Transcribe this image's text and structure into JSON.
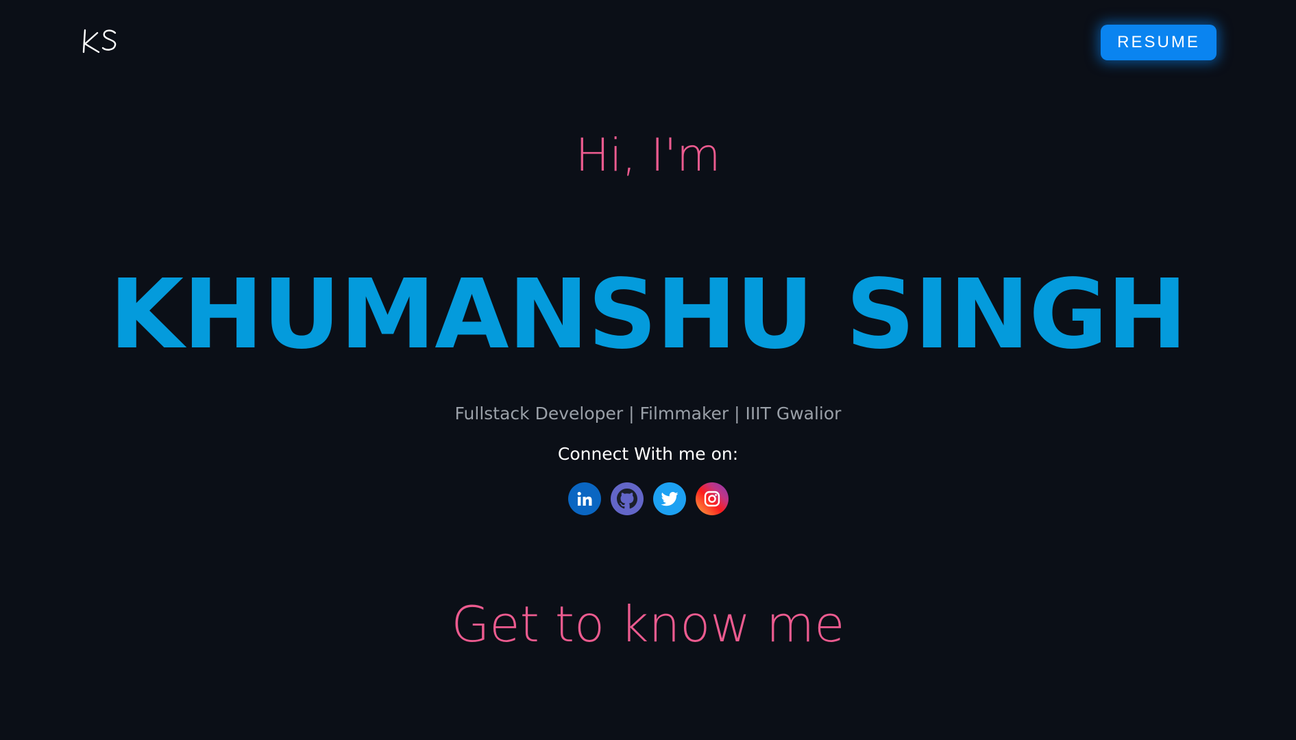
{
  "header": {
    "logo_text": "KS",
    "resume_label": "RESUME"
  },
  "hero": {
    "greeting": "Hi, I'm",
    "name": "KHUMANSHU SINGH",
    "tagline": "Fullstack Developer | Filmmaker | IIIT Gwalior",
    "connect_label": "Connect With me on:"
  },
  "socials": [
    {
      "icon": "linkedin-icon",
      "color": "#0a66c2"
    },
    {
      "icon": "github-icon",
      "color": "#6366c8"
    },
    {
      "icon": "twitter-icon",
      "color": "#1da1f2"
    },
    {
      "icon": "instagram-icon",
      "color": "#c13584"
    }
  ],
  "section": {
    "heading": "Get to know me"
  },
  "colors": {
    "background": "#0b0f17",
    "accent_pink": "#ec5b8f",
    "accent_blue": "#049bdc",
    "button_blue": "#0a84f0"
  }
}
